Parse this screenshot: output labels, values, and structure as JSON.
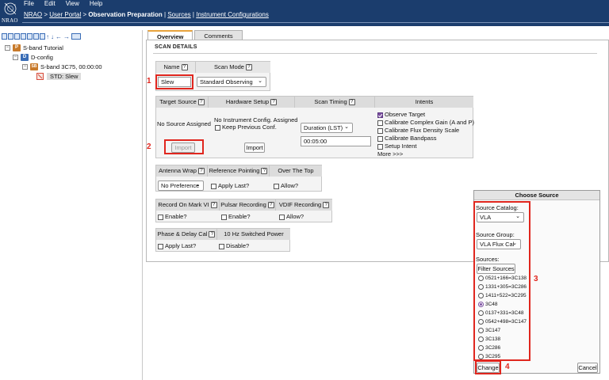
{
  "header": {
    "logo_text": "NRAO",
    "menu": [
      "File",
      "Edit",
      "View",
      "Help"
    ],
    "breadcrumb": {
      "nrao": "NRAO",
      "sep": ">",
      "user_portal": "User Portal",
      "obs_prep": "Observation Preparation",
      "bar": "|",
      "sources": "Sources",
      "instrument_configs": "Instrument Configurations"
    }
  },
  "tree": {
    "items": [
      {
        "label": "S-band Tutorial",
        "icon_letter": "P",
        "icon_color": "#c87a2a"
      },
      {
        "label": "D-config",
        "icon_letter": "D",
        "icon_color": "#3a6db6"
      },
      {
        "label": "S-band 3C75, 00:00:00",
        "icon_letter": "SB",
        "icon_color": "#c87a2a"
      },
      {
        "label": "STD: Slew",
        "icon_letter": "",
        "icon_color": "#d84a3a"
      }
    ]
  },
  "tabs": [
    "Overview",
    "Comments"
  ],
  "section_title": "SCAN DETAILS",
  "form": {
    "name_label": "Name",
    "scan_mode_label": "Scan Mode",
    "name_value": "Slew",
    "scan_mode_value": "Standard Observing",
    "target_source_label": "Target Source",
    "hardware_setup_label": "Hardware Setup",
    "scan_timing_label": "Scan Timing",
    "intents_label": "Intents",
    "no_source": "No Source Assigned",
    "no_config": "No Instrument Config. Assigned",
    "keep_prev": "Keep Previous Conf.",
    "import_disabled": "Import",
    "import": "Import",
    "timing_select": "Duration (LST)",
    "timing_value": "00:05:00",
    "intents": [
      {
        "label": "Observe Target",
        "checked": true
      },
      {
        "label": "Calibrate Complex Gain (A and P)",
        "checked": false
      },
      {
        "label": "Calibrate Flux Density Scale",
        "checked": false
      },
      {
        "label": "Calibrate Bandpass",
        "checked": false
      },
      {
        "label": "Setup Intent",
        "checked": false
      }
    ],
    "more": "More >>>",
    "antenna_wrap_label": "Antenna Wrap",
    "ref_pointing_label": "Reference Pointing",
    "over_top_label": "Over The Top",
    "antenna_wrap_value": "No Preference",
    "apply_last": "Apply Last?",
    "allow": "Allow?",
    "record_mark_label": "Record On Mark VI",
    "pulsar_label": "Pulsar Recording",
    "vdif_label": "VDIF Recording",
    "enable": "Enable?",
    "phase_delay_label": "Phase & Delay Cal",
    "switched_power_label": "10 Hz Switched Power",
    "disable": "Disable?",
    "help": "?"
  },
  "dialog": {
    "title": "Choose Source",
    "catalog_label": "Source Catalog:",
    "catalog_value": "VLA",
    "group_label": "Source Group:",
    "group_value": "VLA Flux Cal",
    "sources_label": "Sources:",
    "filter_button": "Filter Sources",
    "sources": [
      {
        "name": "0521+166=3C138",
        "selected": false
      },
      {
        "name": "1331+305=3C286",
        "selected": false
      },
      {
        "name": "1411+522=3C295",
        "selected": false
      },
      {
        "name": "3C48",
        "selected": true
      },
      {
        "name": "0137+331=3C48",
        "selected": false
      },
      {
        "name": "0542+498=3C147",
        "selected": false
      },
      {
        "name": "3C147",
        "selected": false
      },
      {
        "name": "3C138",
        "selected": false
      },
      {
        "name": "3C286",
        "selected": false
      },
      {
        "name": "3C295",
        "selected": false
      }
    ],
    "change_button": "Change",
    "cancel_button": "Cancel"
  },
  "annotations": [
    "1",
    "2",
    "3",
    "4"
  ],
  "colors": {
    "header_bg": "#1b3d6d",
    "highlight": "#e0261e",
    "accent_tab": "#e8a33c"
  }
}
